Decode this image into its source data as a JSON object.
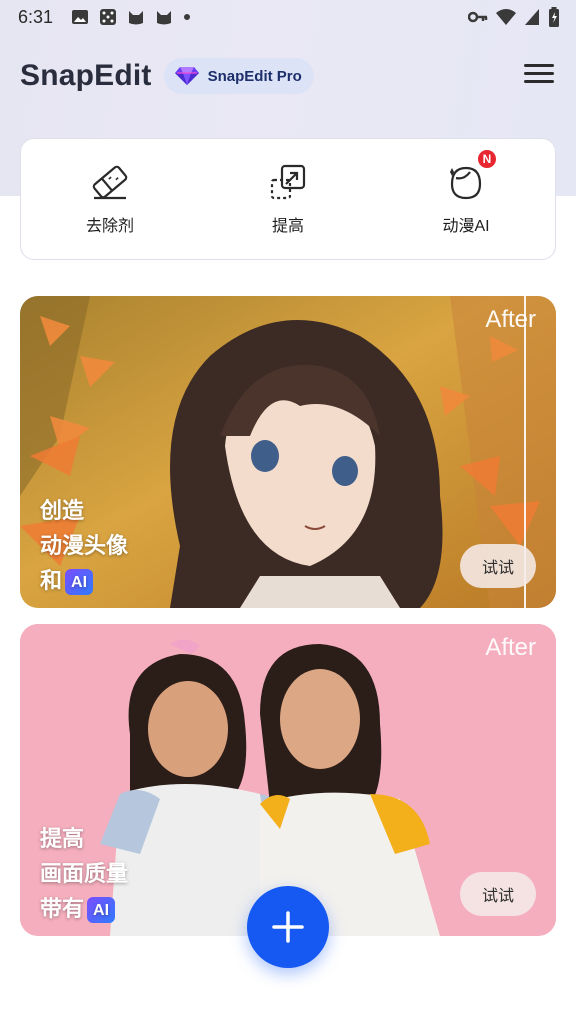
{
  "status_bar": {
    "time": "6:31"
  },
  "header": {
    "app_title": "SnapEdit",
    "pro_label": "SnapEdit Pro"
  },
  "tools": [
    {
      "label": "去除剂",
      "icon": "eraser-icon"
    },
    {
      "label": "提高",
      "icon": "upscale-icon"
    },
    {
      "label": "动漫AI",
      "icon": "anime-face-icon",
      "badge": "N"
    }
  ],
  "cards": {
    "anime": {
      "after": "After",
      "lines": [
        "创造",
        "动漫头像",
        "和"
      ],
      "ai": "AI",
      "try": "试试"
    },
    "enhance": {
      "after": "After",
      "lines": [
        "提高",
        "画面质量",
        "带有"
      ],
      "ai": "AI",
      "try": "试试"
    }
  },
  "colors": {
    "accent": "#1658f2",
    "badge_red": "#e8262f",
    "pro_pill_bg": "#dde3f6"
  }
}
